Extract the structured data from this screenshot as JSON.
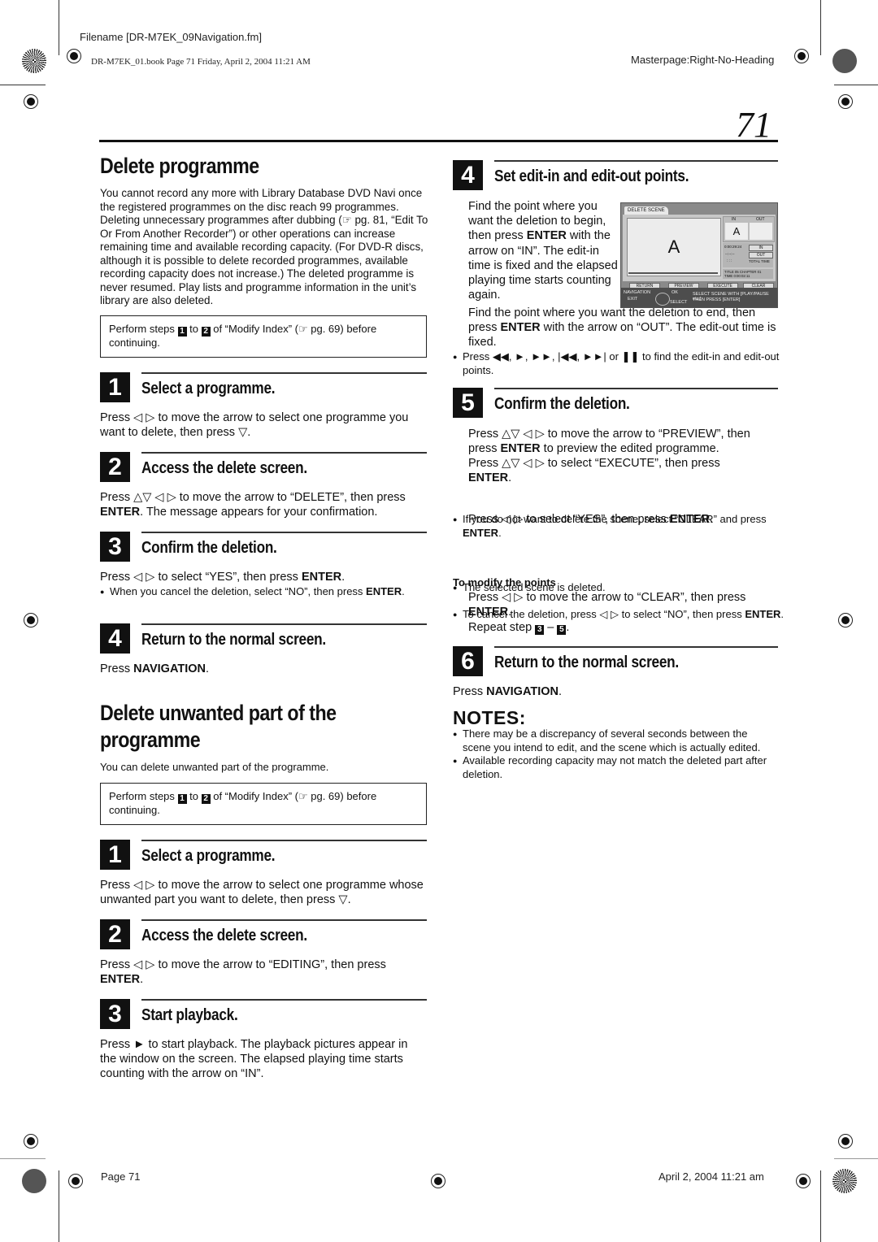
{
  "print_header": {
    "filename": "Filename [DR-M7EK_09Navigation.fm]",
    "book_info": "DR-M7EK_01.book  Page 71  Friday, April 2, 2004  11:21 AM",
    "masterpage": "Masterpage:Right-No-Heading"
  },
  "page_number": "71",
  "left": {
    "section1": {
      "title": "Delete programme",
      "intro": "You cannot record any more with Library Database DVD Navi once the registered programmes on the disc reach 99 programmes. Deleting unnecessary programmes after dubbing (☞ pg. 81, “Edit To Or From Another Recorder”) or other operations can increase remaining time and available recording capacity. (For DVD-R discs, although it is possible to delete recorded programmes, available recording capacity does not increase.) The deleted programme is never resumed. Play lists and programme information in the unit’s library are also deleted.",
      "prereq": {
        "before": "Perform steps ",
        "step_a": "1",
        "mid": " to ",
        "step_b": "2",
        "after": " of “Modify Index” (☞ pg. 69) before continuing."
      },
      "steps": [
        {
          "num": "1",
          "title": "Select a programme.",
          "text": "Press ◁ ▷ to move the arrow to select one programme you want to delete, then press ▽."
        },
        {
          "num": "2",
          "title": "Access the delete screen.",
          "text_pre": "Press △▽ ◁ ▷ to move the arrow to “DELETE”, then press ",
          "text_bold": "ENTER",
          "text_post": ". The message appears for your confirmation."
        },
        {
          "num": "3",
          "title": "Confirm the deletion.",
          "text_pre": "Press ◁ ▷ to select “YES”, then press ",
          "text_bold": "ENTER",
          "text_post": ".",
          "bullet_pre": "When you cancel the deletion, select “NO”, then press ",
          "bullet_bold": "ENTER",
          "bullet_post": "."
        },
        {
          "num": "4",
          "title": "Return to the normal screen.",
          "text_pre": "Press ",
          "text_bold": "NAVIGATION",
          "text_post": "."
        }
      ]
    },
    "section2": {
      "title_line1": "Delete unwanted part of the",
      "title_line2": "programme",
      "intro": "You can delete unwanted part of the programme.",
      "prereq": {
        "before": "Perform steps ",
        "step_a": "1",
        "mid": " to ",
        "step_b": "2",
        "after": " of “Modify Index” (☞ pg. 69) before continuing."
      },
      "steps": [
        {
          "num": "1",
          "title": "Select a programme.",
          "text": "Press ◁ ▷ to move the arrow to select one programme whose unwanted part you want to delete, then press ▽."
        },
        {
          "num": "2",
          "title": "Access the delete screen.",
          "text_pre": "Press ◁ ▷ to move the arrow to “EDITING”, then press ",
          "text_bold": "ENTER",
          "text_post": "."
        },
        {
          "num": "3",
          "title": "Start playback.",
          "text": "Press ► to start playback. The playback pictures appear in the window on the screen. The elapsed playing time starts counting with the arrow on “IN”."
        }
      ]
    }
  },
  "right": {
    "step4": {
      "num": "4",
      "title": "Set edit-in and edit-out points.",
      "p1_pre": "Find the point where you want the deletion to begin, then press ",
      "p1_bold": "ENTER",
      "p1_post": " with the arrow on “IN”. The edit-in time is fixed and the elapsed playing time starts counting again.",
      "p2_pre": "Find the point where you want the deletion to end, then press ",
      "p2_bold": "ENTER",
      "p2_post": " with the arrow on “OUT”. The edit-out time is fixed.",
      "bullet": "Press ◀◀, ►, ►►, |◀◀, ►►| or ❚❚ to find the edit-in and edit-out points."
    },
    "screen": {
      "tab": "DELETE SCENE",
      "preview_letter": "A",
      "in_label": "IN",
      "out_label": "OUT",
      "in_value": "A",
      "timecode": "0:00:29:24",
      "placeholder": "--:--:--",
      "dots": ": : :",
      "btn_in": "IN",
      "btn_out": "OUT",
      "total_time": "TOTAL TIME",
      "title_chapter": "TITLE 05 CHAPTER 01",
      "time": "TIME 0:00:02:11",
      "buttons": [
        "RETURN",
        "PREVIEW",
        "EXECUTE",
        "CLEAR"
      ],
      "nav_label": "NAVIGATION",
      "exit_label": "EXIT",
      "ok_label": "OK",
      "select_label": "SELECT",
      "instruction_line1": "SELECT SCENE WITH [PLAY/PAUSE etc.]",
      "instruction_line2": "THEN PRESS [ENTER]"
    },
    "step5": {
      "num": "5",
      "title": "Confirm the deletion.",
      "p1_pre": "Press △▽ ◁ ▷ to move the arrow to “PREVIEW”, then press ",
      "p1_bold": "ENTER",
      "p1_post": " to preview the edited programme.",
      "p2_pre": "Press △▽ ◁ ▷ to select “EXECUTE”, then press ",
      "p2_bold": "ENTER",
      "p2_post": ".",
      "b1_pre": "If you do not want to delete the scene, select “CLEAR” and press ",
      "b1_bold": "ENTER",
      "b1_post": ".",
      "b1_sub_pre": "Press ◁ ▷ to select “YES”, then press ",
      "b1_sub_bold": "ENTER",
      "b1_sub_post": ".",
      "b2": "The selected scene is deleted.",
      "b3_pre": "To cancel the deletion, press ◁ ▷ to select “NO”, then press ",
      "b3_bold": "ENTER",
      "b3_post": "."
    },
    "modify": {
      "heading": "To modify the points",
      "p1_pre": "Press ◁ ▷ to move the arrow to “CLEAR”, then press ",
      "p1_bold": "ENTER",
      "p1_post": ".",
      "repeat_pre": "Repeat step ",
      "repeat_a": "3",
      "repeat_mid": " – ",
      "repeat_b": "5",
      "repeat_post": "."
    },
    "step6": {
      "num": "6",
      "title": "Return to the normal screen.",
      "text_pre": "Press ",
      "text_bold": "NAVIGATION",
      "text_post": "."
    },
    "notes": {
      "title": "NOTES:",
      "items": [
        "There may be a discrepancy of several seconds between the scene you intend to edit, and the scene which is actually edited.",
        "Available recording capacity may not match the deleted part after deletion."
      ]
    }
  },
  "print_footer": {
    "page": "Page 71",
    "date": "April 2, 2004 11:21 am"
  }
}
